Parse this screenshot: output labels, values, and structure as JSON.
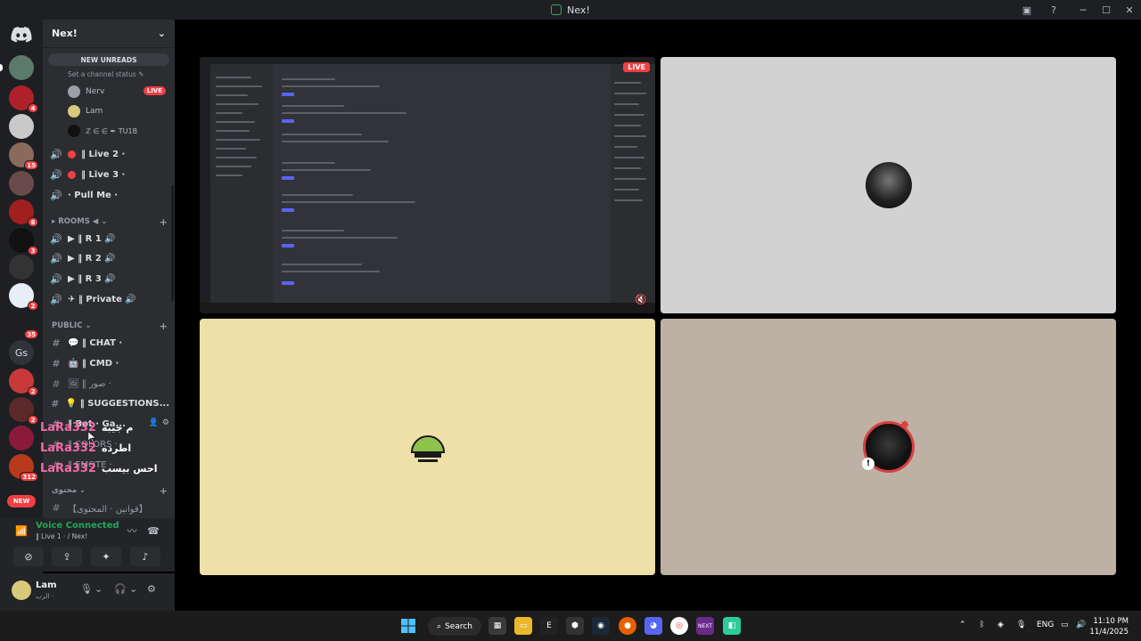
{
  "window": {
    "title": "Nex!"
  },
  "colors": {
    "accent": "#5865f2",
    "live": "#f23f43",
    "connected": "#23a55a",
    "mention": "#f36aa5"
  },
  "servers": [
    {
      "badge": ""
    },
    {
      "badge": "4"
    },
    {
      "badge": ""
    },
    {
      "badge": "15"
    },
    {
      "badge": ""
    },
    {
      "badge": "6"
    },
    {
      "badge": "3"
    },
    {
      "badge": ""
    },
    {
      "badge": "2"
    },
    {
      "badge": "35"
    },
    {
      "label": "Gs",
      "badge": ""
    },
    {
      "badge": "2"
    },
    {
      "badge": "2"
    },
    {
      "badge": ""
    },
    {
      "badge": "312"
    }
  ],
  "server_new_label": "NEW",
  "sidebar": {
    "guild_name": "Nex!",
    "new_unreads": "NEW UNREADS",
    "channel_status": "Set a channel status",
    "voice_users": [
      {
        "name": "Nerv",
        "live": "LIVE"
      },
      {
        "name": "Lam"
      },
      {
        "name": "ℤ ∈ ∈ ✒ TU1B"
      }
    ],
    "channels_top": [
      {
        "label": "‖ Live 2 ·"
      },
      {
        "label": "‖ Live 3 ·"
      },
      {
        "label": "· Pull Me ·"
      }
    ],
    "rooms_category": "ROOMS ◀",
    "rooms": [
      {
        "label": "▶ ‖ R 1 🔊"
      },
      {
        "label": "▶ ‖ R 2 🔊"
      },
      {
        "label": "▶ ‖ R 3 🔊"
      },
      {
        "label": "✈ ‖ Private 🔊"
      }
    ],
    "public_category": "PUBLIC",
    "public": [
      {
        "label": "💬 ‖ CHAT ·"
      },
      {
        "label": "🤖 ‖ CMD ·"
      },
      {
        "label": "🖼 ‖ صور ·"
      },
      {
        "label": "💡 ‖ SUGGESTIONS..."
      },
      {
        "label": "‖ Bot · Ga..."
      },
      {
        "label": "‖ COLORS ·"
      },
      {
        "label": "‖ EMOTE ·"
      }
    ],
    "content_category": "محتوى",
    "content": [
      {
        "label": "【قوانين · المحتوى】"
      }
    ]
  },
  "overlay": [
    {
      "user": "LaRa332",
      "message": "م جيبه"
    },
    {
      "user": "LaRa332",
      "message": "اطرده"
    },
    {
      "user": "LaRa332",
      "message": "احس بيسب"
    }
  ],
  "voice": {
    "status": "Voice Connected",
    "channel": "‖ Live 1 · / Nex!"
  },
  "user": {
    "name": "Lam",
    "status": "الرب ·"
  },
  "stage": {
    "live_label": "LIVE"
  },
  "taskbar": {
    "search": "Search",
    "lang": "ENG",
    "time": "11:10 PM",
    "date": "11/4/2025"
  }
}
